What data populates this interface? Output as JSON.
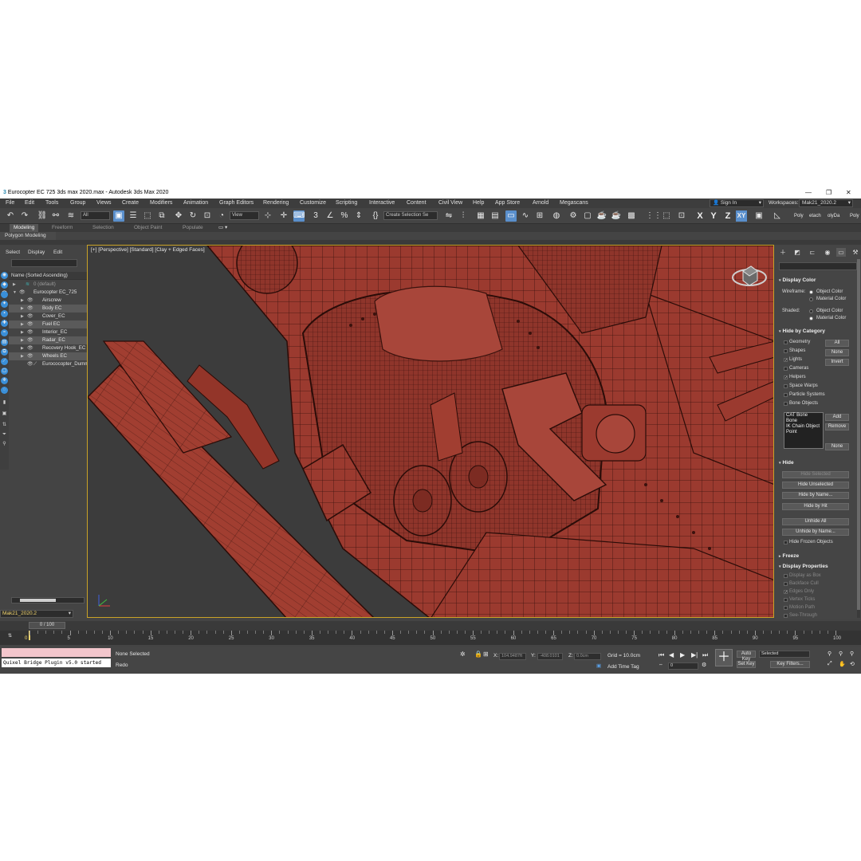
{
  "window": {
    "title": "Eurocopter EC 725 3ds max 2020.max - Autodesk 3ds Max 2020",
    "controls": [
      "—",
      "❐",
      "✕"
    ]
  },
  "menu": [
    "File",
    "Edit",
    "Tools",
    "Group",
    "Views",
    "Create",
    "Modifiers",
    "Animation",
    "Graph Editors",
    "Rendering",
    "Customize",
    "Scripting",
    "Interactive",
    "Content",
    "Civil View",
    "Help",
    "App Store",
    "Arnold",
    "Megascans"
  ],
  "account": {
    "sign_in": "Sign In",
    "workspaces_label": "Workspaces:",
    "workspace_value": "Mak21_2020.2"
  },
  "toolbar": {
    "filter_value": "All",
    "ref_coord_value": "View",
    "selection_set_placeholder": "Create Selection Se",
    "axis_x": "X",
    "axis_y": "Y",
    "axis_z": "Z",
    "axis_xy": "XY",
    "right_tabs": [
      "Poly",
      "etach",
      "olyDa",
      "Poly"
    ]
  },
  "ribbon": {
    "tabs": [
      "Modeling",
      "Freeform",
      "Selection",
      "Object Paint",
      "Populate"
    ],
    "active_tab": "Modeling",
    "sub_label": "Polygon Modeling"
  },
  "explorer": {
    "menu": [
      "Select",
      "Display",
      "Edit"
    ],
    "header": "Name (Sorted Ascending)",
    "rows": [
      {
        "label": "0 (default)",
        "dim": true
      },
      {
        "label": "Eurocopter EC_725",
        "dim": false
      },
      {
        "label": "Airscrew",
        "dim": false
      },
      {
        "label": "Body EC",
        "dim": false
      },
      {
        "label": "Cover_EC",
        "dim": false
      },
      {
        "label": "Fuel EC",
        "dim": false
      },
      {
        "label": "Interior_EC",
        "dim": false
      },
      {
        "label": "Radar_EC",
        "dim": false
      },
      {
        "label": "Recovery Hook_EC",
        "dim": false
      },
      {
        "label": "Wheels EC",
        "dim": false
      },
      {
        "label": "Eurococopter_Dumm",
        "dim": false
      }
    ],
    "layer_value": "Mak21_2020.2"
  },
  "viewport": {
    "label": "[+] [Perspective] [Standard] [Clay + Edged Faces]",
    "mesh_color": "#9b3a2f"
  },
  "command_panel": {
    "display_color": {
      "title": "Display Color",
      "wireframe_label": "Wireframe:",
      "shaded_label": "Shaded:",
      "object_color": "Object Color",
      "material_color": "Material Color"
    },
    "hide_by_category": {
      "title": "Hide by Category",
      "items": [
        {
          "label": "Geometry",
          "checked": false
        },
        {
          "label": "Shapes",
          "checked": false
        },
        {
          "label": "Lights",
          "checked": true
        },
        {
          "label": "Cameras",
          "checked": false
        },
        {
          "label": "Helpers",
          "checked": true
        },
        {
          "label": "Space Warps",
          "checked": false
        },
        {
          "label": "Particle Systems",
          "checked": false
        },
        {
          "label": "Bone Objects",
          "checked": false
        }
      ],
      "btn_all": "All",
      "btn_none": "None",
      "btn_invert": "Invert",
      "list": [
        "CAT Bone",
        "Bone",
        "IK Chain Object",
        "Point"
      ],
      "btn_add": "Add",
      "btn_remove": "Remove",
      "btn_none2": "None"
    },
    "hide": {
      "title": "Hide",
      "buttons": [
        "Hide Selected",
        "Hide Unselected",
        "Hide by Name...",
        "Hide by Hit",
        "Unhide All",
        "Unhide by Name..."
      ],
      "frozen": "Hide Frozen Objects"
    },
    "freeze_title": "Freeze",
    "display_properties": {
      "title": "Display Properties",
      "items": [
        {
          "label": "Display as Box",
          "checked": false
        },
        {
          "label": "Backface Cull",
          "checked": false
        },
        {
          "label": "Edges Only",
          "checked": true
        },
        {
          "label": "Vertex Ticks",
          "checked": false
        },
        {
          "label": "Motion Path",
          "checked": false
        },
        {
          "label": "See-Through",
          "checked": false
        }
      ]
    }
  },
  "timeline": {
    "frame_display": "0 / 100",
    "ticks": [
      "5",
      "10",
      "15",
      "20",
      "25",
      "30",
      "35",
      "40",
      "45",
      "50",
      "55",
      "60",
      "65",
      "70",
      "75",
      "80",
      "85",
      "90",
      "95",
      "100"
    ],
    "start": "0"
  },
  "status": {
    "maxscript_output": "Quixel Bridge Plugin v5.0 started",
    "selection": "None Selected",
    "prompt": "Redo",
    "x_label": "X:",
    "x_value": "104.9487ft",
    "y_label": "Y:",
    "y_value": "-408.0101",
    "z_label": "Z:",
    "z_value": "0.0cm",
    "grid": "Grid = 10.0cm",
    "add_time_tag": "Add Time Tag",
    "auto_key": "Auto Key",
    "set_key": "Set Key",
    "selected_value": "Selected",
    "key_filters": "Key Filters...",
    "frame_value": "0"
  }
}
